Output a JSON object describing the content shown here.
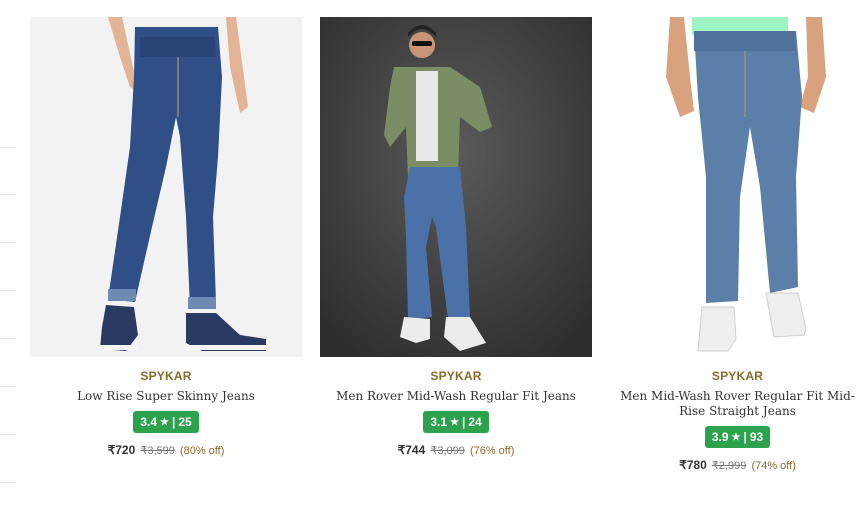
{
  "products": [
    {
      "brand": "SPYKAR",
      "name": "Low Rise Super Skinny Jeans",
      "rating": "3.4",
      "rating_count": "25",
      "price": "₹720",
      "mrp": "₹3,599",
      "discount": "(80% off)"
    },
    {
      "brand": "SPYKAR",
      "name": "Men Rover Mid-Wash Regular Fit Jeans",
      "rating": "3.1",
      "rating_count": "24",
      "price": "₹744",
      "mrp": "₹3,099",
      "discount": "(76% off)"
    },
    {
      "brand": "SPYKAR",
      "name": "Men Mid-Wash Rover Regular Fit Mid-Rise Straight Jeans",
      "rating": "3.9",
      "rating_count": "93",
      "price": "₹780",
      "mrp": "₹2,999",
      "discount": "(74% off)"
    }
  ],
  "rating_separator": "|",
  "star_glyph": "★",
  "colors": {
    "brand": "#8b6a2b",
    "rating_badge": "#2ca24c",
    "denim_dark": "#2f4f86",
    "denim_light": "#5b7fa8"
  }
}
